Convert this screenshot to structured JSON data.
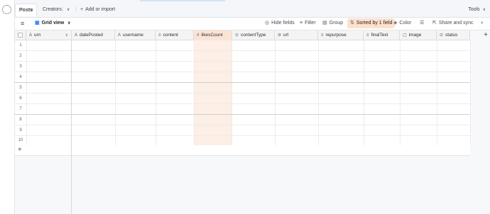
{
  "tabs": [
    {
      "label": "Posts",
      "active": true
    },
    {
      "label": "Creators",
      "active": false
    }
  ],
  "tabbar": {
    "more_chevron": "∨",
    "add_import": "Add or import",
    "tools": "Tools"
  },
  "toolbar": {
    "view_name": "Grid view",
    "hide_fields": "Hide fields",
    "filter": "Filter",
    "group": "Group",
    "sorted": "Sorted by 1 field",
    "color": "Color",
    "share_sync": "Share and sync"
  },
  "columns": [
    {
      "label": "urn",
      "icon": "A"
    },
    {
      "label": "datePosted",
      "icon": "A"
    },
    {
      "label": "username",
      "icon": "A"
    },
    {
      "label": "content",
      "icon": "≡"
    },
    {
      "label": "likesCount",
      "icon": "#"
    },
    {
      "label": "contentType",
      "icon": "⊙"
    },
    {
      "label": "url",
      "icon": "⊘"
    },
    {
      "label": "repurpose",
      "icon": "≡"
    },
    {
      "label": "finalText",
      "icon": "≡"
    },
    {
      "label": "image",
      "icon": "▢"
    },
    {
      "label": "status",
      "icon": "⊙"
    }
  ],
  "rows": [
    "1",
    "2",
    "3",
    "4",
    "5",
    "6",
    "7",
    "8",
    "9",
    "10"
  ],
  "colors": {
    "sort_highlight": "#fdeee6",
    "sorted_button": "#ffe0cc",
    "accent_blue": "#2d7ff9"
  }
}
